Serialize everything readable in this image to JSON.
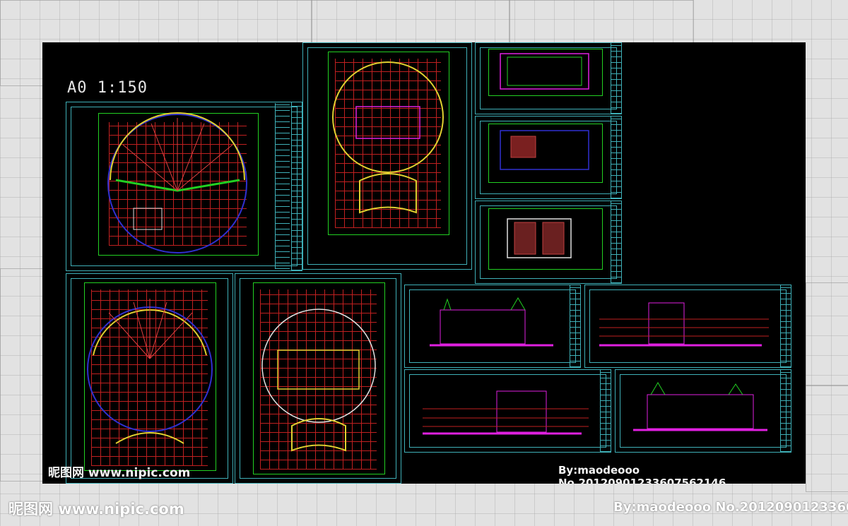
{
  "drawing": {
    "scale_label": "A0   1:150"
  },
  "watermark": {
    "site_cn": "昵图网",
    "site_url": "www.nipic.com",
    "author": "By:maodeooo",
    "number": "No.20120901233607562146",
    "number_bottom": "No.2012090123360"
  },
  "colors": {
    "canvas": "#000000",
    "frame": "#3fb0b8",
    "grid": "#c02020",
    "dimension": "#22d022",
    "outline": "#e0d030",
    "facade": "#e020e0",
    "arc_blue": "#3030d0"
  }
}
